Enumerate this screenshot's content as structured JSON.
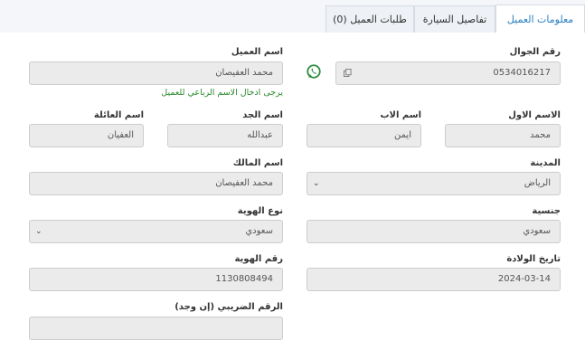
{
  "tabs": [
    {
      "label": "معلومات العميل"
    },
    {
      "label": "تفاصيل السيارة"
    },
    {
      "label": "طلبات العميل (0)"
    }
  ],
  "form": {
    "mobile": {
      "label": "رقم الجوال",
      "value": "0534016217"
    },
    "client_name": {
      "label": "اسم العميل",
      "value": "محمد العفيصان",
      "hint": "يرجى ادخال الاسم الرباعي للعميل"
    },
    "first_name": {
      "label": "الاسم الاول",
      "value": "محمد"
    },
    "father_name": {
      "label": "اسم الاب",
      "value": "ايمن"
    },
    "grandfather_name": {
      "label": "اسم الجد",
      "value": "عبدالله"
    },
    "family_name": {
      "label": "اسم العائلة",
      "value": "العفيان"
    },
    "city": {
      "label": "المدينة",
      "value": "الرياض"
    },
    "owner_name": {
      "label": "اسم المالك",
      "value": "محمد العفيصان"
    },
    "nationality": {
      "label": "جنسية",
      "value": "سعودي"
    },
    "id_type": {
      "label": "نوع الهوية",
      "value": "سعودي"
    },
    "birth_date": {
      "label": "تاريخ الولادة",
      "value": "2024-03-14"
    },
    "id_number": {
      "label": "رقم الهوية",
      "value": "1130808494"
    },
    "tax_number": {
      "label": "الرقم الضريبي (إن وجد)",
      "value": ""
    }
  },
  "icons": {
    "whatsapp": "whatsapp-icon",
    "copy": "copy-icon",
    "dropdown": "chevron-down-icon"
  },
  "colors": {
    "active_tab": "#2a7fc0",
    "hint": "#2a8a2a",
    "whatsapp": "#2e8b3e"
  }
}
